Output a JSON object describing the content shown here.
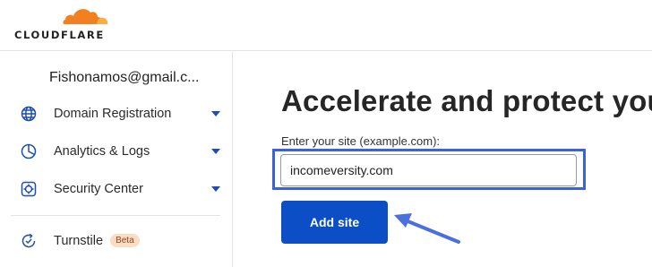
{
  "brand": {
    "name": "CLOUDFLARE",
    "colors": {
      "orange": "#f38020",
      "orange_light": "#faae40",
      "accent_blue": "#0b4ec6",
      "highlight_blue": "#3b63d9"
    }
  },
  "sidebar": {
    "account": "Fishonamos@gmail.c...",
    "items": [
      {
        "label": "Domain Registration",
        "icon": "globe-icon",
        "has_caret": true
      },
      {
        "label": "Analytics & Logs",
        "icon": "pie-chart-icon",
        "has_caret": true
      },
      {
        "label": "Security Center",
        "icon": "security-gear-icon",
        "has_caret": true
      },
      {
        "label": "Turnstile",
        "icon": "turnstile-icon",
        "badge": "Beta"
      }
    ]
  },
  "main": {
    "headline": "Accelerate and protect your s",
    "field_label": "Enter your site (example.com):",
    "site_value": "incomeversity.com",
    "add_button": "Add site"
  }
}
